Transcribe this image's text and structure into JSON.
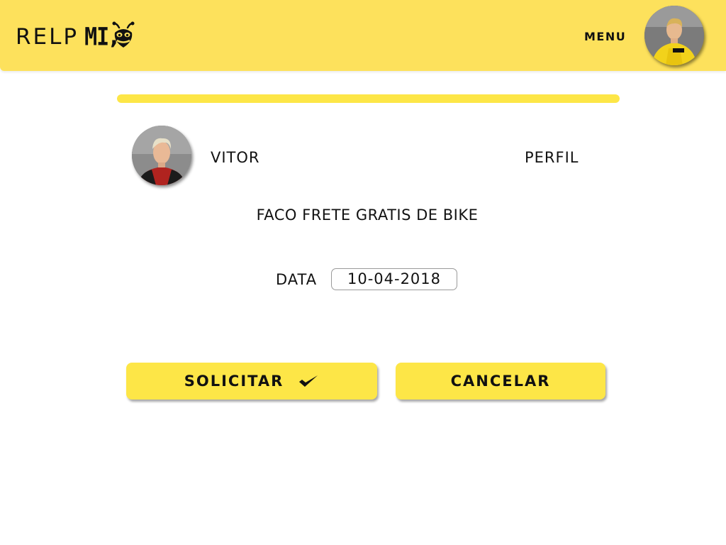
{
  "header": {
    "logo_light": "RELP",
    "logo_bold": "MI",
    "logo_comma": ",",
    "logo_icon": "bee-icon",
    "menu_label": "MENU",
    "avatar_icon": "user-avatar-photo"
  },
  "progress": {
    "fraction": 1.0
  },
  "request": {
    "user_name": "VITOR",
    "profile_link": "PERFIL",
    "description": "FACO FRETE GRATIS DE BIKE",
    "date_label": "DATA",
    "date_value": "10-04-2018"
  },
  "actions": {
    "submit_label": "SOLICITAR",
    "submit_icon": "checkmark-icon",
    "cancel_label": "CANCELAR"
  },
  "colors": {
    "brand_yellow": "#fde15c",
    "button_yellow": "#fde647",
    "text": "#111111"
  }
}
